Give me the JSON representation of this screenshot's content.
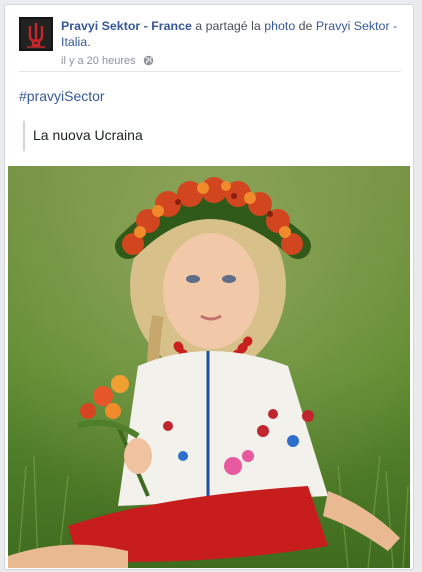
{
  "post": {
    "page_name": "Pravyi Sektor - France",
    "shared_text": " a partagé la ",
    "photo_word": "photo",
    "from_text": " de ",
    "source_page": "Pravyi Sektor - Italia",
    "source_period": ".",
    "timestamp": "il y a 20 heures",
    "privacy_icon": "globe-icon",
    "hashtag": "#pravyiSector",
    "quote": "La nuova Ucraina"
  },
  "colors": {
    "link": "#365899",
    "text": "#1d2129",
    "meta": "#90949c",
    "card_border": "#d3d6db"
  }
}
